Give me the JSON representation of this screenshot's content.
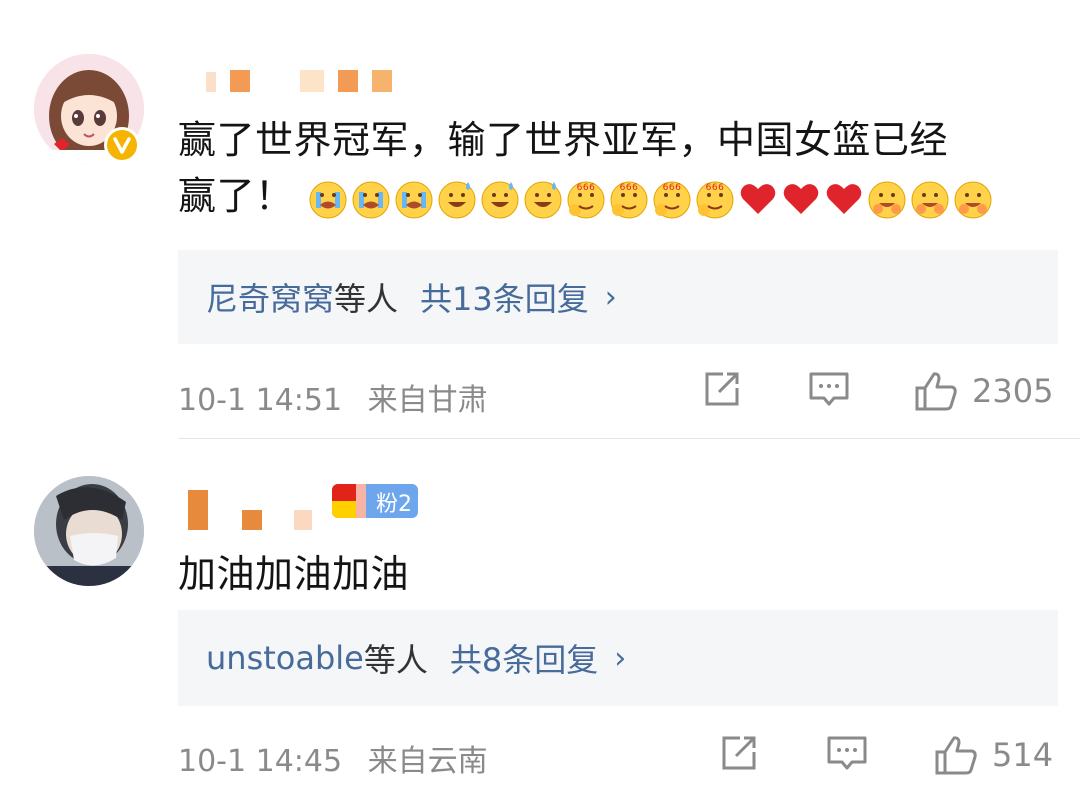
{
  "comments": [
    {
      "avatar": "anime-girl-avatar",
      "verified": true,
      "text_line1": "赢了世界冠军，输了世界亚军，中国女篮已经",
      "text_line2": "赢了！",
      "emojis": [
        "crying-face-emoji",
        "crying-face-emoji",
        "crying-face-emoji",
        "sweat-smile-emoji",
        "sweat-smile-emoji",
        "sweat-smile-emoji",
        "666-emoji",
        "666-emoji",
        "666-emoji",
        "666-emoji",
        "red-heart-emoji",
        "red-heart-emoji",
        "red-heart-emoji",
        "hug-face-emoji",
        "hug-face-emoji",
        "hug-face-emoji"
      ],
      "reply_names": "尼奇窝窝",
      "reply_etc": "等人",
      "reply_count": "共13条回复",
      "reply_chevron": "›",
      "time": "10-1 14:51",
      "location": "来自甘肃",
      "likes": "2305"
    },
    {
      "avatar": "masked-person-avatar",
      "fan_badge": "粉2",
      "text_line1": "加油加油加油",
      "reply_names": "unstoable",
      "reply_etc": "等人",
      "reply_count": "共8条回复",
      "reply_chevron": "›",
      "time": "10-1 14:45",
      "location": "来自云南",
      "likes": "514"
    }
  ],
  "colors": {
    "link": "#476b9a",
    "meta": "#8a8a8a",
    "reply_bg": "#f5f6f8",
    "verified_badge": "#f4b400",
    "fan_badge": "#6ea6ee",
    "heart": "#e0242c"
  }
}
